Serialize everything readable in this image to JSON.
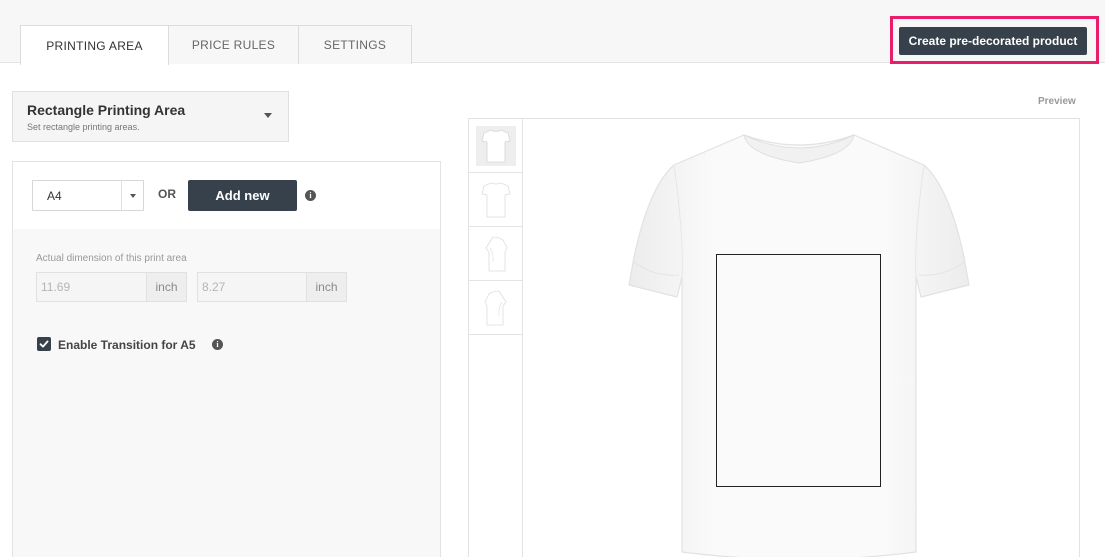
{
  "tabs": [
    {
      "label": "PRINTING AREA",
      "active": true
    },
    {
      "label": "PRICE RULES",
      "active": false
    },
    {
      "label": "SETTINGS",
      "active": false
    }
  ],
  "header": {
    "create_button_label": "Create pre-decorated product",
    "highlight_color": "#ea1d6b"
  },
  "area_select": {
    "title": "Rectangle Printing Area",
    "subtitle": "Set rectangle printing areas."
  },
  "size_select": {
    "value": "A4"
  },
  "or_label": "OR",
  "add_button_label": "Add new",
  "dimensions": {
    "label": "Actual dimension of this print area",
    "width_value": "11.69",
    "width_unit": "inch",
    "height_value": "8.27",
    "height_unit": "inch"
  },
  "transition": {
    "label": "Enable Transition for A5",
    "checked": true
  },
  "preview": {
    "label": "Preview",
    "views": [
      "front-view",
      "back-view",
      "left-view",
      "right-view"
    ]
  },
  "colors": {
    "dark_button": "#37414b",
    "accent": "#ea1d6b"
  }
}
